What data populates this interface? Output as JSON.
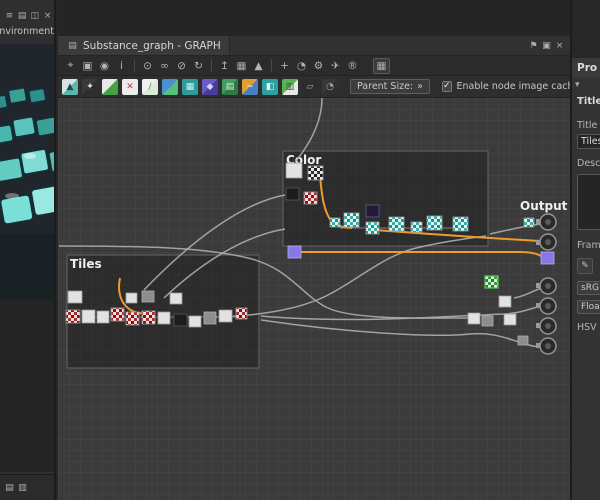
{
  "left_panel": {
    "menu_label": "Environment",
    "header_icons": [
      {
        "name": "panel-grip-icon",
        "glyph": "≡"
      },
      {
        "name": "panel-split-icon",
        "glyph": "▤"
      },
      {
        "name": "panel-float-icon",
        "glyph": "◫"
      },
      {
        "name": "panel-close-icon",
        "glyph": "×"
      }
    ],
    "footer_icons": [
      {
        "name": "panel-layers-icon",
        "glyph": "▤"
      },
      {
        "name": "panel-list-icon",
        "glyph": "▥"
      }
    ]
  },
  "graph_window": {
    "tab_title": "Substance_graph - GRAPH",
    "tab_icons": [
      {
        "name": "graph-tab-icon",
        "glyph": "▤"
      }
    ],
    "window_icons": [
      {
        "name": "pin-icon",
        "glyph": "⚑"
      },
      {
        "name": "dock-icon",
        "glyph": "▣"
      },
      {
        "name": "close-icon",
        "glyph": "×"
      }
    ]
  },
  "toolbar_main": {
    "icons": [
      {
        "name": "marquee-select-icon",
        "glyph": "⌖"
      },
      {
        "name": "fit-frame-icon",
        "glyph": "▣"
      },
      {
        "name": "screenshot-icon",
        "glyph": "◉"
      },
      {
        "name": "info-icon",
        "glyph": "i"
      },
      {
        "sep": true
      },
      {
        "name": "zoom-icon",
        "glyph": "⊙"
      },
      {
        "name": "link-icon",
        "glyph": "∞"
      },
      {
        "name": "unlink-icon",
        "glyph": "⊘"
      },
      {
        "name": "refresh-icon",
        "glyph": "↻"
      },
      {
        "sep": true
      },
      {
        "name": "export-icon",
        "glyph": "↥"
      },
      {
        "name": "snap-grid-icon",
        "glyph": "▦"
      },
      {
        "name": "pointer-icon",
        "glyph": "▲"
      },
      {
        "sep": true
      },
      {
        "name": "add-node-icon",
        "glyph": "+"
      },
      {
        "name": "timer-icon",
        "glyph": "◔"
      },
      {
        "name": "settings-icon",
        "glyph": "⚙"
      },
      {
        "name": "send-icon",
        "glyph": "✈"
      },
      {
        "name": "registered-icon",
        "glyph": "®"
      },
      {
        "name": "layout-grid-button",
        "glyph": "▦",
        "boxed": true
      }
    ]
  },
  "toolbar_nodes": {
    "icons": [
      {
        "name": "bitmap-node-icon",
        "glyph": "▲",
        "c1": "#d9e2e2",
        "c2": "#59b7ae",
        "fg": "#1f4d4a"
      },
      {
        "name": "svg-node-icon",
        "glyph": "✦",
        "c1": "#3a3a3a",
        "c2": "#2e2e2e",
        "fg": "#cfe8ff"
      },
      {
        "name": "uniform-color-icon",
        "glyph": "",
        "c1": "#e8e8e8",
        "c2": "#46a046"
      },
      {
        "name": "blend-node-icon",
        "glyph": "✕",
        "c1": "#ececec",
        "c2": "#ececec",
        "fg": "#c03a3a"
      },
      {
        "name": "blur-node-icon",
        "glyph": "/",
        "c1": "#f0f0f0",
        "c2": "#d8ecd8",
        "fg": "#3f9f3f"
      },
      {
        "name": "gradient-node-icon",
        "glyph": "",
        "c1": "#4a90d0",
        "c2": "#54c07a"
      },
      {
        "name": "tile-generator-icon",
        "glyph": "▦",
        "c1": "#2f9b9b",
        "c2": "#2f9b9b",
        "fg": "#d6f2f0"
      },
      {
        "name": "fx-map-icon",
        "glyph": "◆",
        "c1": "#6a5ac8",
        "c2": "#4a3a9a",
        "fg": "#d8d0ff"
      },
      {
        "name": "normal-map-icon",
        "glyph": "▤",
        "c1": "#3f9f5f",
        "c2": "#2c7a44",
        "fg": "#d8f0e0"
      },
      {
        "name": "curve-node-icon",
        "glyph": "~",
        "c1": "#e0a030",
        "c2": "#4a80c0",
        "fg": "#ffffff"
      },
      {
        "name": "hsl-node-icon",
        "glyph": "◧",
        "c1": "#2fa0a0",
        "c2": "#2fa0a0",
        "fg": "#e0f4f4"
      },
      {
        "name": "levels-node-icon",
        "glyph": "▥",
        "c1": "#58b058",
        "c2": "#e8e8e8",
        "fg": "#2a5a2a"
      },
      {
        "name": "transform-node-icon",
        "glyph": "▱",
        "c1": "#2c2c2c",
        "c2": "#2c2c2c",
        "fg": "#a8a8a8"
      },
      {
        "name": "pixel-processor-icon",
        "glyph": "◔",
        "c1": "#383838",
        "c2": "#303030",
        "fg": "#a8a8a8"
      }
    ],
    "parent_size_label": "Parent Size:",
    "parent_size_chevron": "»",
    "cache_checkbox_label": "Enable node image cache",
    "cache_checkbox_checked": true,
    "checkmark": "✓",
    "dual_view_glyph": "◆◆"
  },
  "canvas": {
    "frames": [
      {
        "label": "Tiles"
      },
      {
        "label": "Color"
      }
    ],
    "output_label": "Output"
  },
  "properties_panel": {
    "header": "Pro",
    "collapse_glyph": "▾",
    "section_title": "Title V",
    "title_label": "Title",
    "title_value": "Tiles",
    "description_label": "Desc",
    "frame_label": "Fram",
    "edit_icon_glyph": "✎",
    "srgb_button": "sRG",
    "float_button": "Floa",
    "hsv_label": "HSV"
  }
}
